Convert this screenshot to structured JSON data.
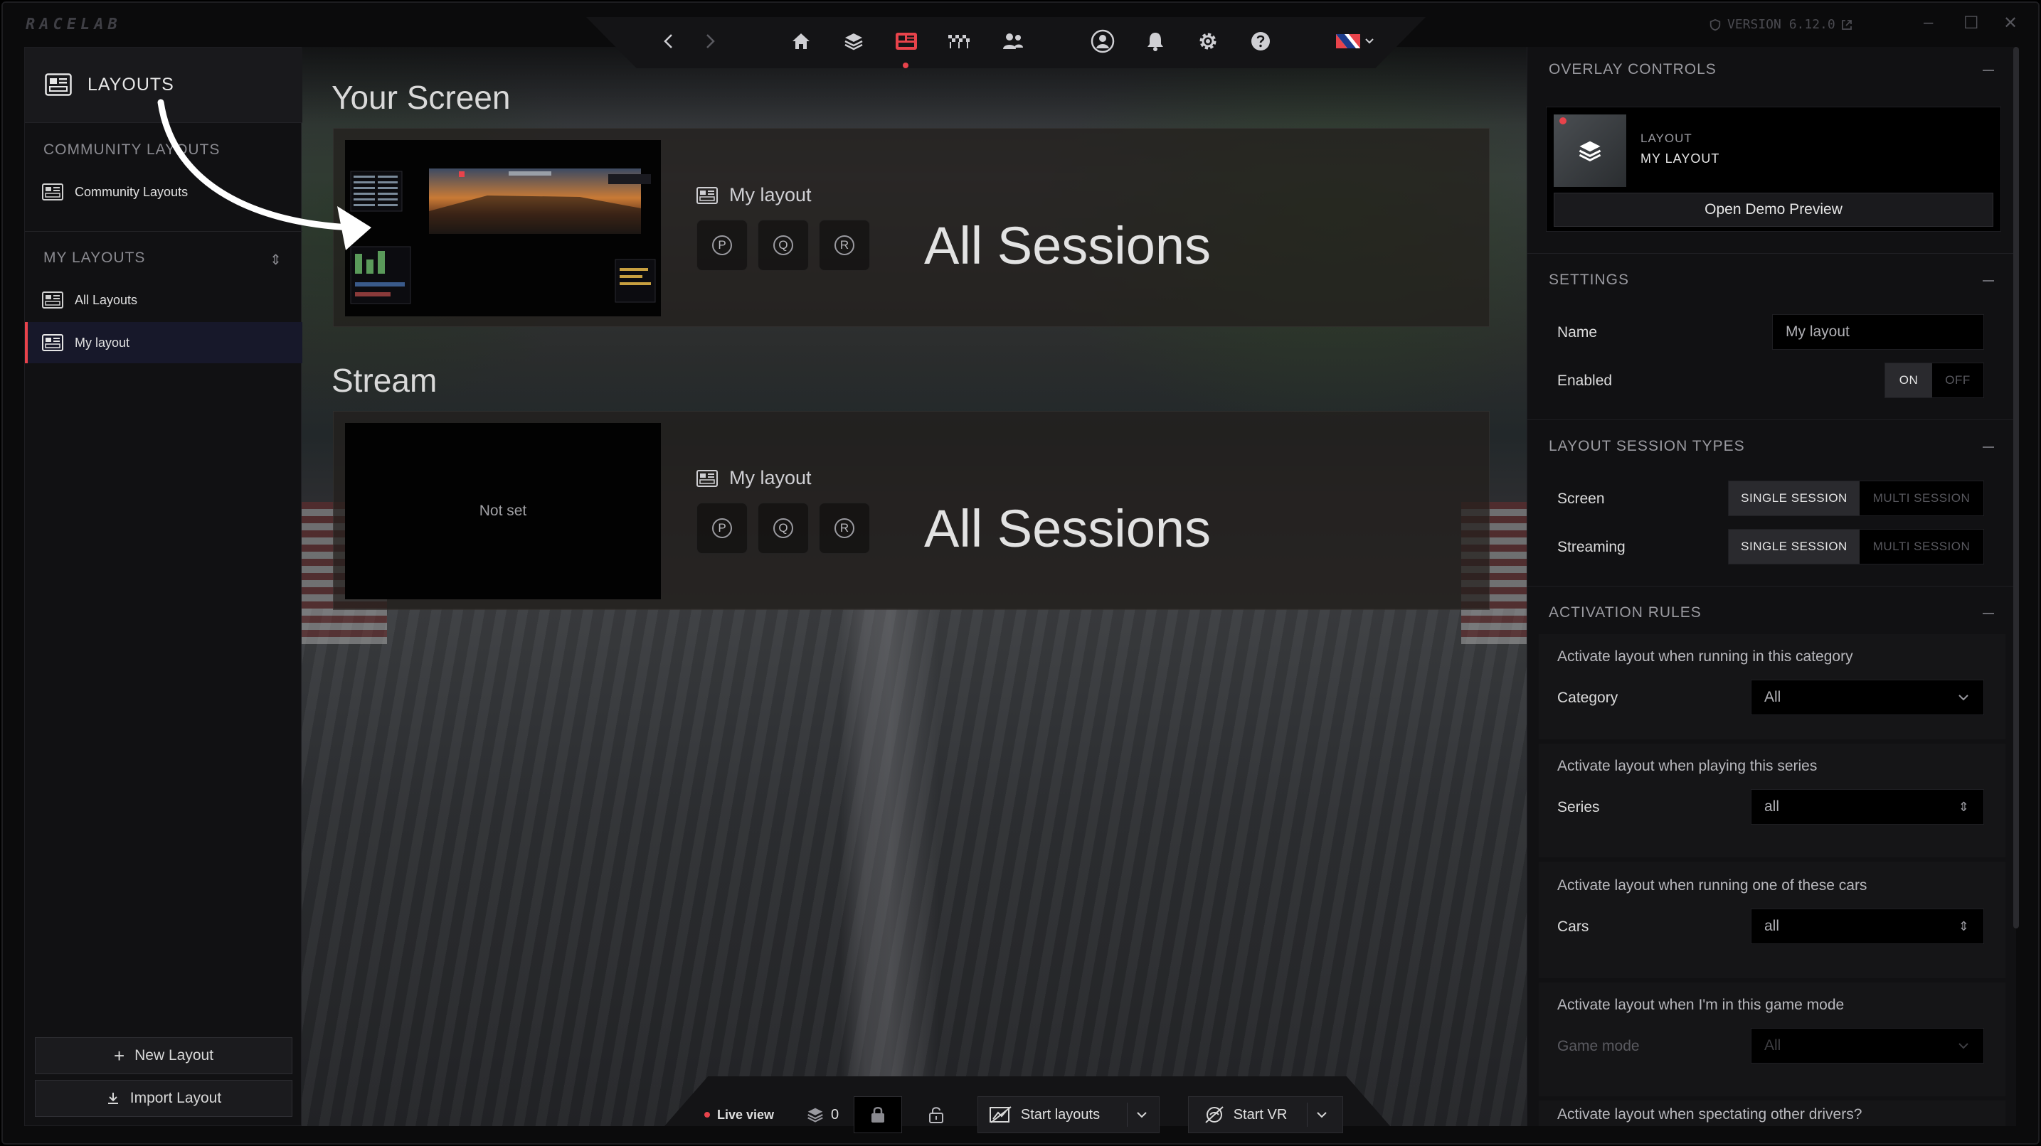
{
  "app": {
    "logo": "RACELAB",
    "version": "VERSION 6.12.0",
    "colors": {
      "accent": "#e8434b",
      "panel": "#111113",
      "background": "#0b0b0c"
    }
  },
  "nav": {
    "icons": [
      "chevron-left-icon",
      "chevron-right-icon",
      "home-icon",
      "layers-icon",
      "layouts-icon",
      "race-flag-icon",
      "team-icon",
      "profile-icon",
      "bell-icon",
      "gear-icon",
      "help-icon",
      "flag-icon"
    ],
    "active": "layouts-icon"
  },
  "sidebar": {
    "title": "LAYOUTS",
    "community_section": "COMMUNITY LAYOUTS",
    "community_item": "Community Layouts",
    "my_section": "MY LAYOUTS",
    "items": [
      {
        "label": "All Layouts"
      },
      {
        "label": "My layout"
      }
    ],
    "new_layout": "New Layout",
    "import_layout": "Import Layout"
  },
  "main": {
    "screen": {
      "title": "Your Screen",
      "layout_name": "My layout",
      "sessions": [
        "P",
        "Q",
        "R"
      ],
      "session_label": "All Sessions"
    },
    "stream": {
      "title": "Stream",
      "thumbnail_text": "Not set",
      "layout_name": "My layout",
      "sessions": [
        "P",
        "Q",
        "R"
      ],
      "session_label": "All Sessions"
    }
  },
  "bottombar": {
    "live_view": "Live view",
    "layer_count": "0",
    "start_layouts": "Start layouts",
    "start_vr": "Start VR"
  },
  "rightpanel": {
    "overlay": {
      "title": "OVERLAY CONTROLS",
      "label": "LAYOUT",
      "name": "MY LAYOUT",
      "button": "Open Demo Preview"
    },
    "settings": {
      "title": "SETTINGS",
      "name_label": "Name",
      "name_value": "My layout",
      "enabled_label": "Enabled",
      "on": "ON",
      "off": "OFF",
      "enabled": true
    },
    "session_types": {
      "title": "LAYOUT SESSION TYPES",
      "screen_label": "Screen",
      "streaming_label": "Streaming",
      "single": "SINGLE SESSION",
      "multi": "MULTI SESSION",
      "screen_selected": "SINGLE SESSION",
      "streaming_selected": "SINGLE SESSION"
    },
    "activation": {
      "title": "ACTIVATION RULES",
      "category_desc": "Activate layout when running in this category",
      "category_label": "Category",
      "category_value": "All",
      "series_desc": "Activate layout when playing this series",
      "series_label": "Series",
      "series_value": "all",
      "cars_desc": "Activate layout when running one of these cars",
      "cars_label": "Cars",
      "cars_value": "all",
      "gamemode_desc": "Activate layout when I'm in this game mode",
      "gamemode_label": "Game mode",
      "gamemode_value": "All",
      "spectating_desc": "Activate layout when spectating other drivers?"
    }
  }
}
